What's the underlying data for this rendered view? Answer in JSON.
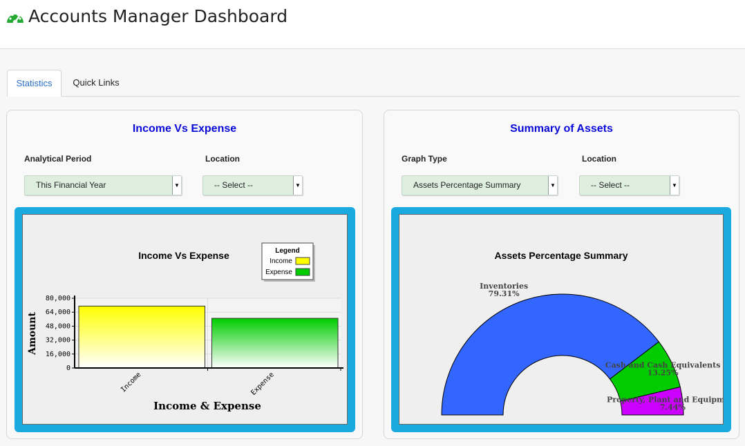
{
  "header": {
    "title": "Accounts Manager Dashboard",
    "icon": "dashboard-gauge-icon",
    "icon_color": "#22aa33"
  },
  "tabs": [
    {
      "label": "Statistics",
      "active": true
    },
    {
      "label": "Quick Links",
      "active": false
    }
  ],
  "left_panel": {
    "title": "Income Vs Expense",
    "period_label": "Analytical Period",
    "period_value": "This Financial Year",
    "location_label": "Location",
    "location_value": "-- Select --"
  },
  "right_panel": {
    "title": "Summary of Assets",
    "graph_type_label": "Graph Type",
    "graph_type_value": "Assets Percentage Summary",
    "location_label": "Location",
    "location_value": "-- Select --"
  },
  "colors": {
    "accent_title": "#0a0ad8",
    "chart_frame": "#1aaae0",
    "tab_active": "#2a6fc9"
  },
  "chart_data": [
    {
      "type": "bar",
      "title": "Income Vs Expense",
      "xlabel": "Income & Expense",
      "ylabel": "Amount",
      "categories": [
        "Income",
        "Expense"
      ],
      "values": [
        71000,
        57000
      ],
      "colors": [
        "#ffff00",
        "#00cc00"
      ],
      "ylim": [
        0,
        80000
      ],
      "yticks": [
        "0",
        "16,000",
        "32,000",
        "48,000",
        "64,000",
        "80,000"
      ],
      "legend": {
        "title": "Legend",
        "entries": [
          "Income",
          "Expense"
        ],
        "position": "top-right"
      },
      "grid": true
    },
    {
      "type": "pie",
      "title": "Assets Percentage Summary",
      "slices": [
        {
          "label": "Inventories",
          "value": 79.31,
          "display": "79.31%",
          "color": "#3366ff"
        },
        {
          "label": "Cash and Cash Equivalents",
          "value": 13.25,
          "display": "13.25%",
          "color": "#00cc00"
        },
        {
          "label": "Property, Plant and Equipment",
          "value": 7.44,
          "display": "7.44%",
          "color": "#cc00ff"
        }
      ]
    }
  ]
}
